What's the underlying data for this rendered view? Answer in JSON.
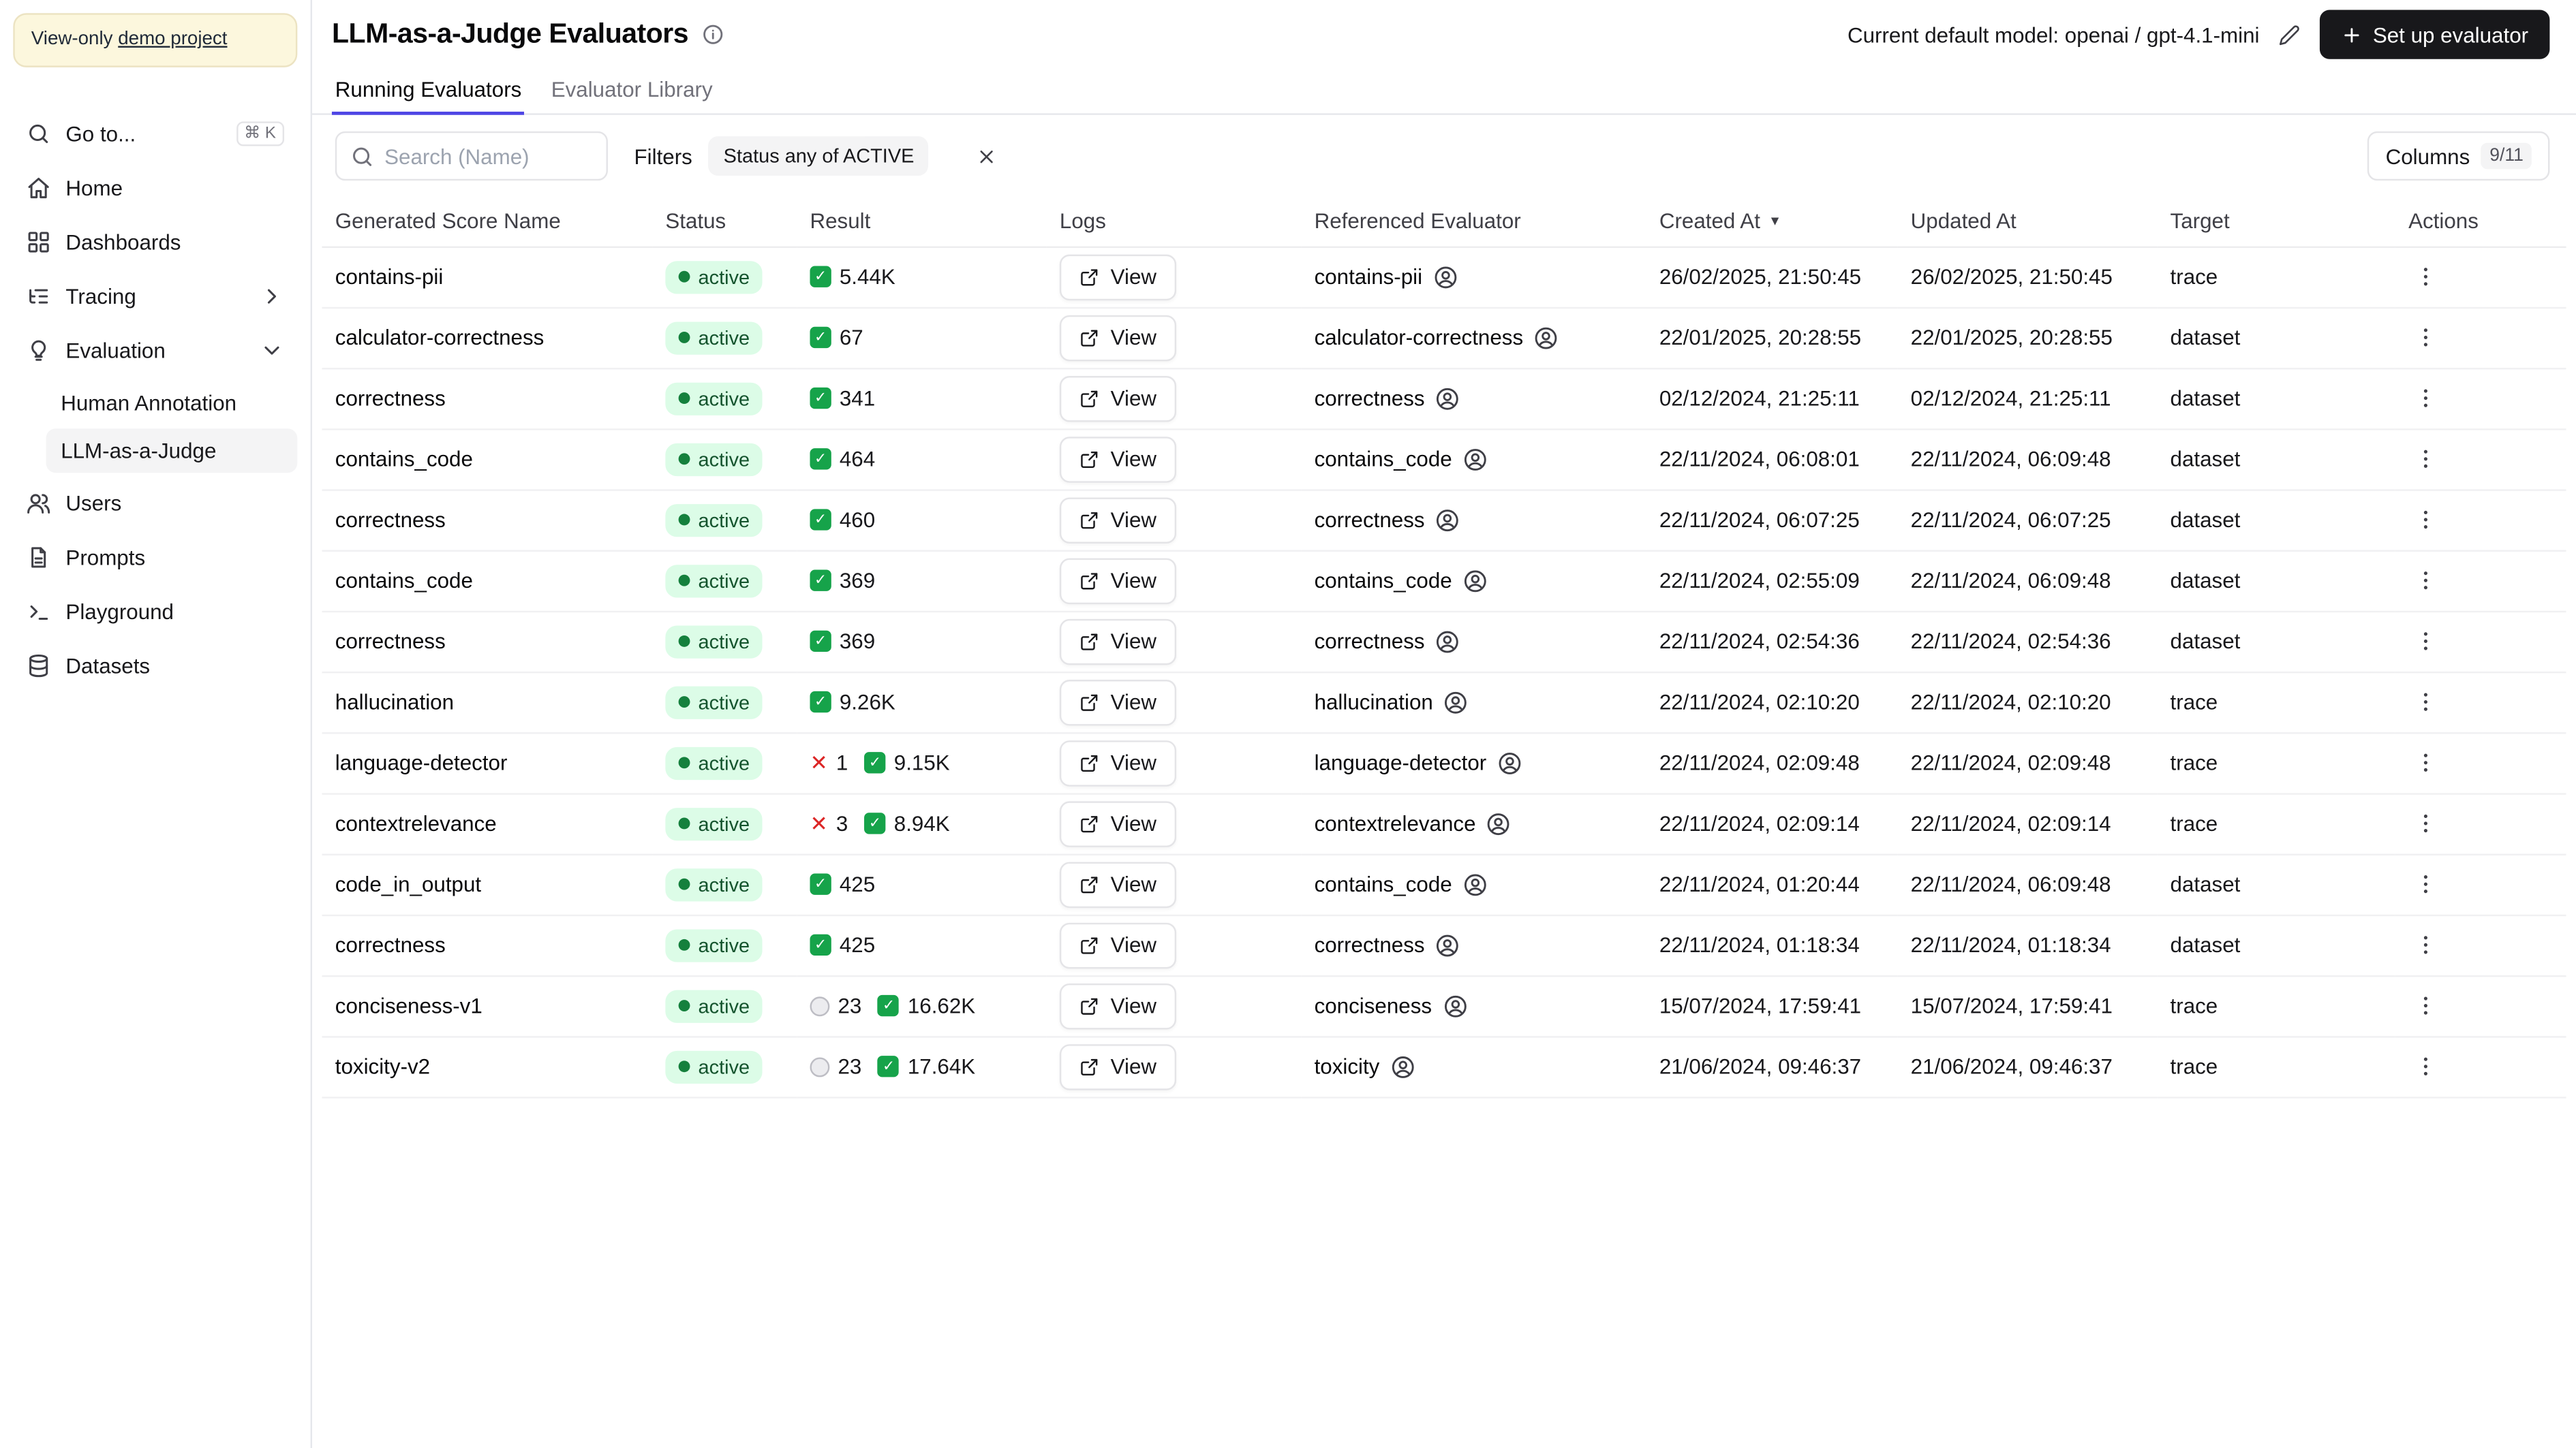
{
  "colors": {
    "accent": "#4f46e5",
    "status-bg": "#dcfce7",
    "status-dot": "#15803d",
    "success-green": "#16a34a",
    "error-red": "#dc2626",
    "button-dark": "#18181b",
    "banner-bg": "#fcf7dd",
    "border": "#e5e7eb"
  },
  "icons": {
    "success_check": "✓",
    "error_x": "✕",
    "sort_desc": "▼"
  },
  "sidebar": {
    "banner": {
      "prefix": "View-only",
      "link_label": "demo project"
    },
    "goto": {
      "label": "Go to...",
      "shortcut": "⌘ K"
    },
    "items": {
      "home": "Home",
      "dashboards": "Dashboards",
      "tracing": "Tracing",
      "evaluation": "Evaluation",
      "human_annotation": "Human Annotation",
      "llm_judge": "LLM-as-a-Judge",
      "users": "Users",
      "prompts": "Prompts",
      "playground": "Playground",
      "datasets": "Datasets"
    }
  },
  "header": {
    "title": "LLM-as-a-Judge Evaluators",
    "default_model_label": "Current default model: openai / gpt-4.1-mini",
    "setup_button_label": "Set up evaluator"
  },
  "tabs": {
    "running": "Running Evaluators",
    "library": "Evaluator Library"
  },
  "toolbar": {
    "search_placeholder": "Search (Name)",
    "filters_label": "Filters",
    "filter_chip": "Status any of ACTIVE",
    "columns_label": "Columns",
    "columns_count": "9/11"
  },
  "table": {
    "columns": [
      "Generated Score Name",
      "Status",
      "Result",
      "Logs",
      "Referenced Evaluator",
      "Created At",
      "Updated At",
      "Target",
      "Actions"
    ],
    "rows": [
      {
        "name": "contains-pii",
        "status": "active",
        "result_pending": null,
        "result_error": null,
        "result_success": "5.44K",
        "logs": "View",
        "evaluator": "contains-pii",
        "created": "26/02/2025, 21:50:45",
        "updated": "26/02/2025, 21:50:45",
        "target": "trace"
      },
      {
        "name": "calculator-correctness",
        "status": "active",
        "result_pending": null,
        "result_error": null,
        "result_success": "67",
        "logs": "View",
        "evaluator": "calculator-correctness",
        "created": "22/01/2025, 20:28:55",
        "updated": "22/01/2025, 20:28:55",
        "target": "dataset"
      },
      {
        "name": "correctness",
        "status": "active",
        "result_pending": null,
        "result_error": null,
        "result_success": "341",
        "logs": "View",
        "evaluator": "correctness",
        "created": "02/12/2024, 21:25:11",
        "updated": "02/12/2024, 21:25:11",
        "target": "dataset"
      },
      {
        "name": "contains_code",
        "status": "active",
        "result_pending": null,
        "result_error": null,
        "result_success": "464",
        "logs": "View",
        "evaluator": "contains_code",
        "created": "22/11/2024, 06:08:01",
        "updated": "22/11/2024, 06:09:48",
        "target": "dataset"
      },
      {
        "name": "correctness",
        "status": "active",
        "result_pending": null,
        "result_error": null,
        "result_success": "460",
        "logs": "View",
        "evaluator": "correctness",
        "created": "22/11/2024, 06:07:25",
        "updated": "22/11/2024, 06:07:25",
        "target": "dataset"
      },
      {
        "name": "contains_code",
        "status": "active",
        "result_pending": null,
        "result_error": null,
        "result_success": "369",
        "logs": "View",
        "evaluator": "contains_code",
        "created": "22/11/2024, 02:55:09",
        "updated": "22/11/2024, 06:09:48",
        "target": "dataset"
      },
      {
        "name": "correctness",
        "status": "active",
        "result_pending": null,
        "result_error": null,
        "result_success": "369",
        "logs": "View",
        "evaluator": "correctness",
        "created": "22/11/2024, 02:54:36",
        "updated": "22/11/2024, 02:54:36",
        "target": "dataset"
      },
      {
        "name": "hallucination",
        "status": "active",
        "result_pending": null,
        "result_error": null,
        "result_success": "9.26K",
        "logs": "View",
        "evaluator": "hallucination",
        "created": "22/11/2024, 02:10:20",
        "updated": "22/11/2024, 02:10:20",
        "target": "trace"
      },
      {
        "name": "language-detector",
        "status": "active",
        "result_pending": null,
        "result_error": "1",
        "result_success": "9.15K",
        "logs": "View",
        "evaluator": "language-detector",
        "created": "22/11/2024, 02:09:48",
        "updated": "22/11/2024, 02:09:48",
        "target": "trace"
      },
      {
        "name": "contextrelevance",
        "status": "active",
        "result_pending": null,
        "result_error": "3",
        "result_success": "8.94K",
        "logs": "View",
        "evaluator": "contextrelevance",
        "created": "22/11/2024, 02:09:14",
        "updated": "22/11/2024, 02:09:14",
        "target": "trace"
      },
      {
        "name": "code_in_output",
        "status": "active",
        "result_pending": null,
        "result_error": null,
        "result_success": "425",
        "logs": "View",
        "evaluator": "contains_code",
        "created": "22/11/2024, 01:20:44",
        "updated": "22/11/2024, 06:09:48",
        "target": "dataset"
      },
      {
        "name": "correctness",
        "status": "active",
        "result_pending": null,
        "result_error": null,
        "result_success": "425",
        "logs": "View",
        "evaluator": "correctness",
        "created": "22/11/2024, 01:18:34",
        "updated": "22/11/2024, 01:18:34",
        "target": "dataset"
      },
      {
        "name": "conciseness-v1",
        "status": "active",
        "result_pending": "23",
        "result_error": null,
        "result_success": "16.62K",
        "logs": "View",
        "evaluator": "conciseness",
        "created": "15/07/2024, 17:59:41",
        "updated": "15/07/2024, 17:59:41",
        "target": "trace"
      },
      {
        "name": "toxicity-v2",
        "status": "active",
        "result_pending": "23",
        "result_error": null,
        "result_success": "17.64K",
        "logs": "View",
        "evaluator": "toxicity",
        "created": "21/06/2024, 09:46:37",
        "updated": "21/06/2024, 09:46:37",
        "target": "trace"
      }
    ]
  }
}
